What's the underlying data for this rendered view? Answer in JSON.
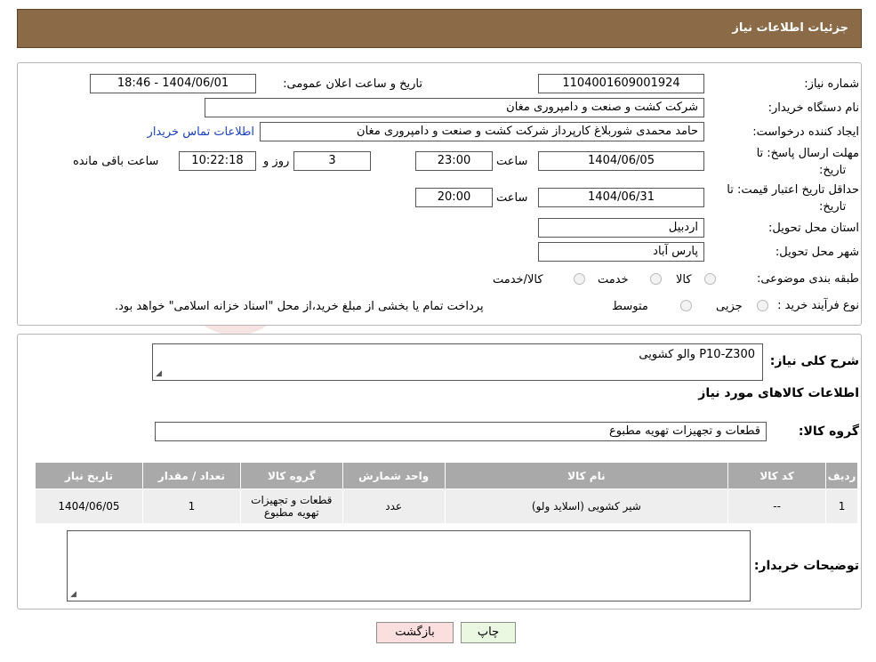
{
  "header": {
    "title": "جزئیات اطلاعات نیاز"
  },
  "form": {
    "need_number_label": "شماره نیاز:",
    "need_number": "1104001609001924",
    "announce_label": "تاریخ و ساعت اعلان عمومی:",
    "announce_value": "1404/06/01 - 18:46",
    "buyer_org_label": "نام دستگاه خریدار:",
    "buyer_org": "شرکت کشت و صنعت و دامپروری مغان",
    "creator_label": "ایجاد کننده درخواست:",
    "creator": "حامد محمدی شوربلاغ کارپرداز شرکت کشت و صنعت و دامپروری مغان",
    "contact_link": "اطلاعات تماس خریدار",
    "deadline_label_1": "مهلت ارسال پاسخ: تا",
    "deadline_label_2": "تاریخ:",
    "deadline_date": "1404/06/05",
    "time_label": "ساعت",
    "deadline_time": "23:00",
    "days": "3",
    "days_label": "روز و",
    "remaining_time": "10:22:18",
    "remaining_label": "ساعت باقی مانده",
    "validity_label_1": "حداقل تاریخ اعتبار قیمت: تا",
    "validity_label_2": "تاریخ:",
    "validity_date": "1404/06/31",
    "validity_time_label": "ساعت",
    "validity_time": "20:00",
    "province_label": "استان محل تحویل:",
    "province": "اردبیل",
    "city_label": "شهر محل تحویل:",
    "city": "پارس آباد",
    "category_label": "طبقه بندی موضوعی:",
    "category_options": [
      "کالا",
      "خدمت",
      "کالا/خدمت"
    ],
    "process_label": "نوع فرآیند خرید :",
    "process_options": [
      "جزیی",
      "متوسط"
    ],
    "process_note": "پرداخت تمام یا بخشی از مبلغ خرید،از محل \"اسناد خزانه اسلامی\" خواهد بود."
  },
  "details": {
    "summary_label": "شرح کلی نیاز:",
    "summary_value": "والو کشویی  P10-Z300",
    "goods_info_title": "اطلاعات کالاهای مورد نیاز",
    "group_label": "گروه کالا:",
    "group_value": "قطعات و تجهیزات تهویه مطبوع",
    "table": {
      "headers": [
        "ردیف",
        "کد کالا",
        "نام کالا",
        "واحد شمارش",
        "گروه کالا",
        "تعداد / مقدار",
        "تاریخ نیاز"
      ],
      "rows": [
        [
          "1",
          "--",
          "شیر کشویی (اسلاید ولو)",
          "عدد",
          "قطعات و تجهیزات تهویه مطبوع",
          "1",
          "1404/06/05"
        ]
      ]
    },
    "buyer_notes_label": "توضیحات خریدار:",
    "buyer_notes_value": ""
  },
  "buttons": {
    "print": "چاپ",
    "back": "بازگشت"
  },
  "watermark": {
    "text": "AriaTender.neT"
  },
  "colors": {
    "header": "#8b6b47",
    "back_button": "#fbdede",
    "print_button": "#eaf8e2",
    "link": "#1a3fb8"
  }
}
